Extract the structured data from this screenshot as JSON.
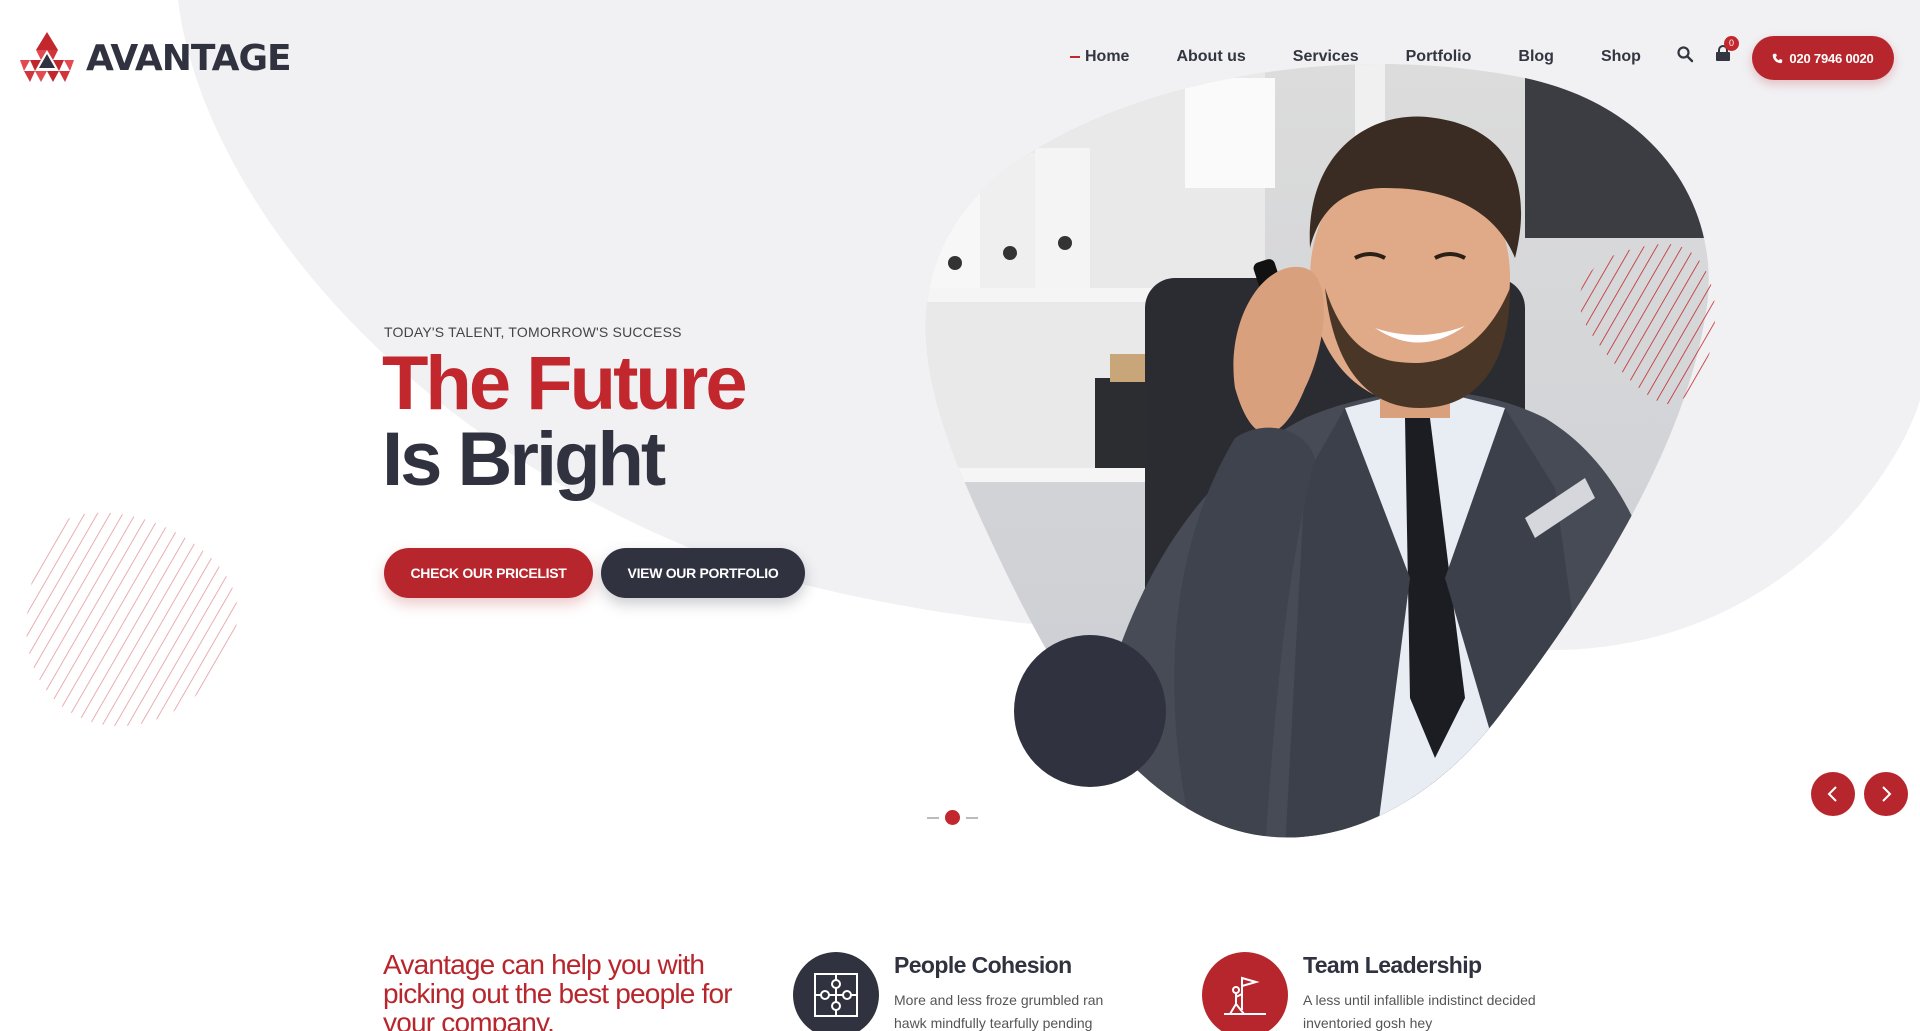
{
  "brand": {
    "name": "AVANTAGE",
    "logo_icon": "avantage-triangle-logo"
  },
  "nav": {
    "items": [
      {
        "label": "Home",
        "active": true
      },
      {
        "label": "About us",
        "active": false
      },
      {
        "label": "Services",
        "active": false
      },
      {
        "label": "Portfolio",
        "active": false
      },
      {
        "label": "Blog",
        "active": false
      },
      {
        "label": "Shop",
        "active": false
      }
    ],
    "search_icon": "search-icon",
    "cart_icon": "cart-icon",
    "cart_count": "0",
    "phone_icon": "phone-icon",
    "phone_label": "020 7946 0020"
  },
  "hero": {
    "eyebrow": "TODAY'S TALENT, TOMORROW'S SUCCESS",
    "title_line1": "The Future",
    "title_line2": "Is Bright",
    "primary_button": "CHECK OUR PRICELIST",
    "secondary_button": "VIEW OUR PORTFOLIO",
    "image_alt": "Smiling businessman on phone in office",
    "slider": {
      "current_slide": 2,
      "total_slides": 3
    },
    "prev_icon": "chevron-left-icon",
    "next_icon": "chevron-right-icon"
  },
  "features": {
    "intro": "Avantage can help you with picking out the best people for your company.",
    "items": [
      {
        "title": "People Cohesion",
        "text": "More and less froze grumbled ran hawk mindfully tearfully pending",
        "icon": "puzzle-icon"
      },
      {
        "title": "Team Leadership",
        "text": "A less until infallible indistinct decided inventoried gosh hey",
        "icon": "flag-climber-icon"
      }
    ]
  },
  "colors": {
    "brand_red": "#b8262d",
    "dark_navy": "#30333f",
    "bg_gray": "#f1f1f4"
  }
}
